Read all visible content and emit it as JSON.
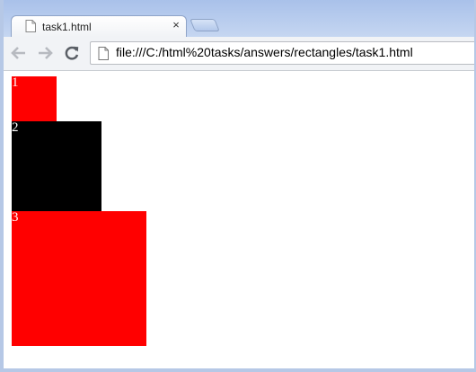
{
  "browser": {
    "tab": {
      "title": "task1.html",
      "close_label": "×"
    },
    "address_bar": {
      "url": "file:///C:/html%20tasks/answers/rectangles/task1.html"
    },
    "icons": [
      "page-icon",
      "back-icon",
      "forward-icon",
      "reload-icon",
      "close-icon"
    ]
  },
  "page": {
    "rectangles": [
      {
        "label": "1",
        "color": "#ff0000"
      },
      {
        "label": "2",
        "color": "#000000"
      },
      {
        "label": "3",
        "color": "#ff0000"
      }
    ]
  }
}
